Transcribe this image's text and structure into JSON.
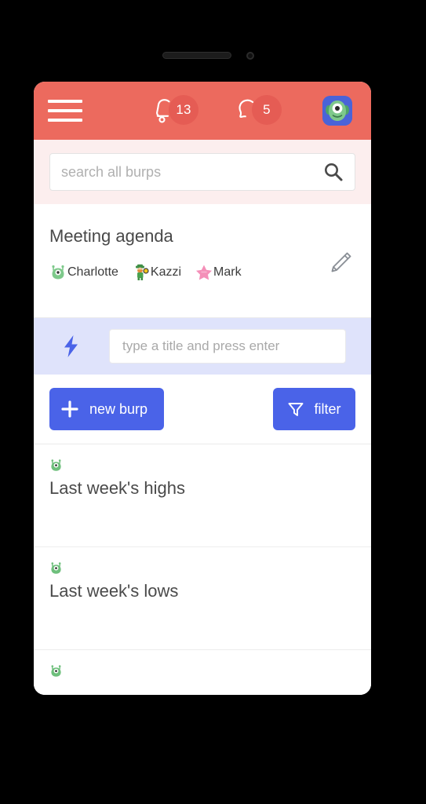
{
  "device": {
    "speaker": "earpiece-speaker",
    "camera": "front-camera"
  },
  "header": {
    "menu_label": "menu",
    "notifications": {
      "icon": "bell-icon",
      "count": "13"
    },
    "messages": {
      "icon": "chat-bubble-icon",
      "count": "5"
    },
    "avatar": {
      "icon": "monster-avatar",
      "label": "profile"
    },
    "background_color": "#ec6a5e"
  },
  "search": {
    "placeholder": "search all burps",
    "value": "",
    "icon": "search-icon",
    "band_color": "#fceeee"
  },
  "agenda": {
    "title": "Meeting agenda",
    "edit_icon": "pencil-icon",
    "people": [
      {
        "name": "Charlotte",
        "avatar": "green-monster"
      },
      {
        "name": "Kazzi",
        "avatar": "leprechaun"
      },
      {
        "name": "Mark",
        "avatar": "pink-star"
      }
    ]
  },
  "quick_add": {
    "icon": "lightning-bolt-icon",
    "placeholder": "type a title and press enter",
    "value": "",
    "band_color": "#dfe3fb"
  },
  "actions": {
    "new_burp_label": "new burp",
    "new_burp_icon": "plus-icon",
    "filter_label": "filter",
    "filter_icon": "funnel-icon",
    "button_color": "#4a63e8"
  },
  "burps": [
    {
      "title": "Last week's highs",
      "avatar": "green-monster"
    },
    {
      "title": "Last week's lows",
      "avatar": "green-monster"
    },
    {
      "title": "",
      "avatar": "green-monster"
    }
  ]
}
